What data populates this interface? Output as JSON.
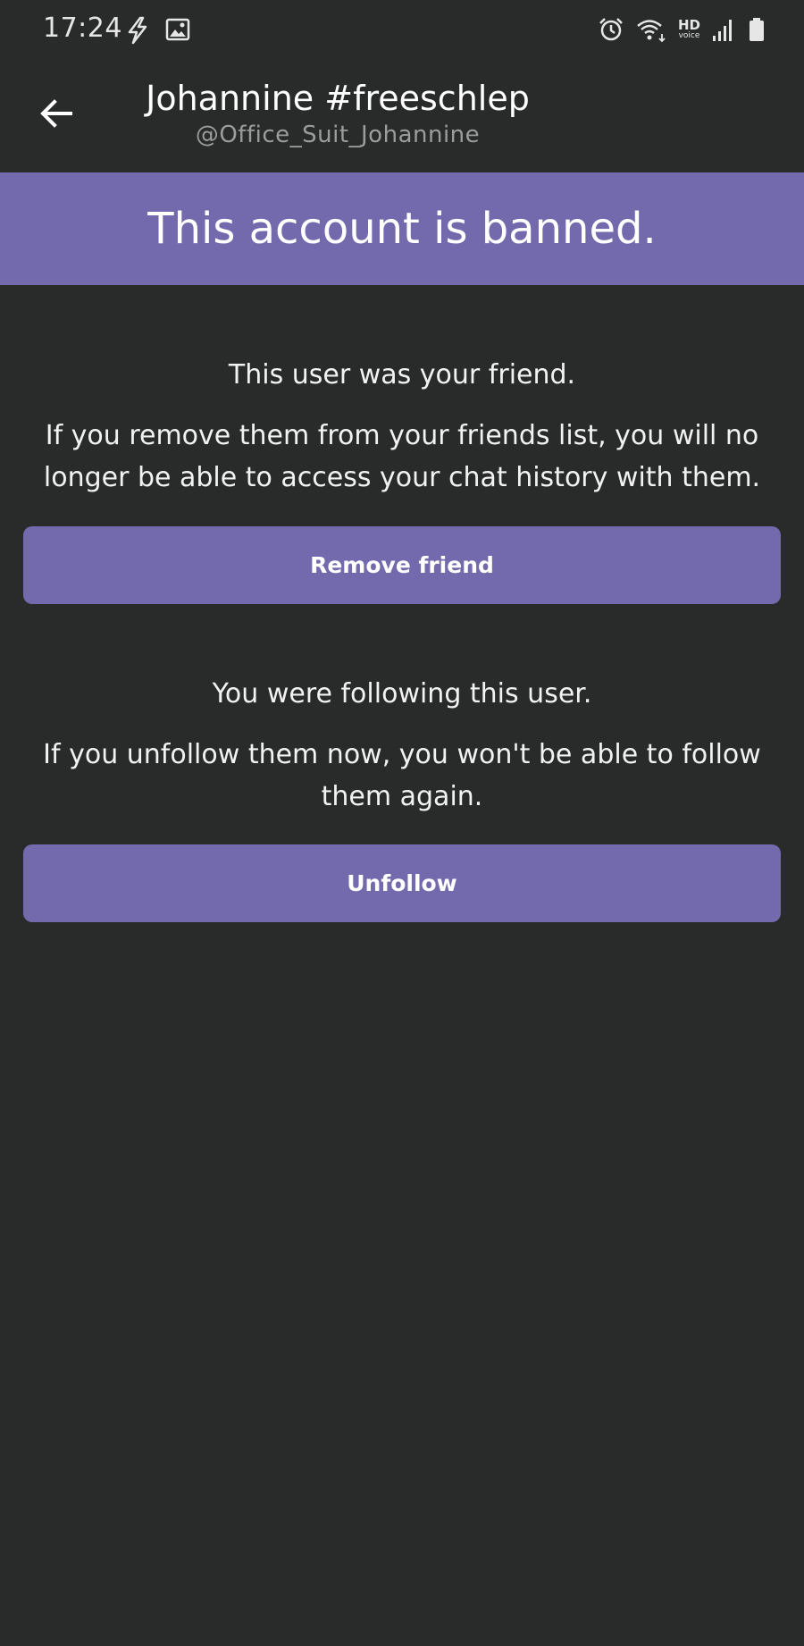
{
  "status_bar": {
    "time": "17:24",
    "hd_label": "HD",
    "voice_label": "voice",
    "left_icons": [
      "flash-icon",
      "image-icon"
    ],
    "right_icons": [
      "alarm-icon",
      "wifi-icon",
      "hd-voice-icon",
      "signal-icon",
      "battery-icon"
    ]
  },
  "header": {
    "display_name": "Johannine #freeschlep",
    "username": "@Office_Suit_Johannine",
    "back_icon": "arrow-left-icon"
  },
  "banner": {
    "text": "This account is banned."
  },
  "friend_section": {
    "heading": "This user was your friend.",
    "body": "If you remove them from your friends list, you will no longer be able to access your chat history with them.",
    "button_label": "Remove friend"
  },
  "follow_section": {
    "heading": "You were following this user.",
    "body": "If you unfollow them now, you won't be able to follow them again.",
    "button_label": "Unfollow"
  },
  "colors": {
    "background": "#282b29",
    "accent": "#7369ad",
    "text": "#ffffff",
    "muted_text": "#9a9d9b"
  }
}
